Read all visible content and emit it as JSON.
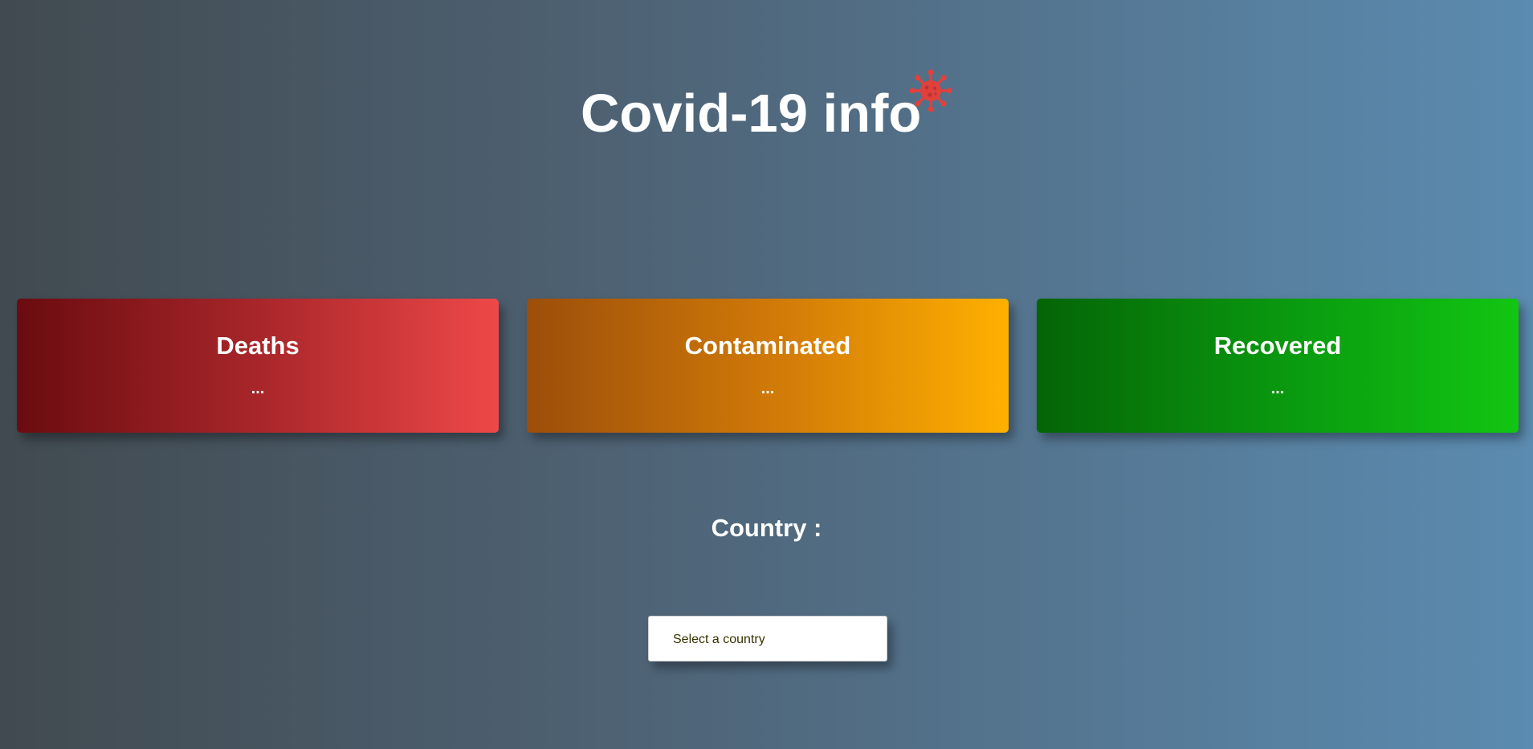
{
  "header": {
    "title": "Covid-19 info",
    "icon": "virus-icon",
    "icon_color": "#e0413c"
  },
  "cards": [
    {
      "key": "deaths",
      "title": "Deaths",
      "value": "...",
      "color": "#a8262a"
    },
    {
      "key": "contaminated",
      "title": "Contaminated",
      "value": "...",
      "color": "#d47d08"
    },
    {
      "key": "recovered",
      "title": "Recovered",
      "value": "...",
      "color": "#0a9c10"
    }
  ],
  "country": {
    "label": "Country :",
    "select_placeholder": "Select a country"
  }
}
